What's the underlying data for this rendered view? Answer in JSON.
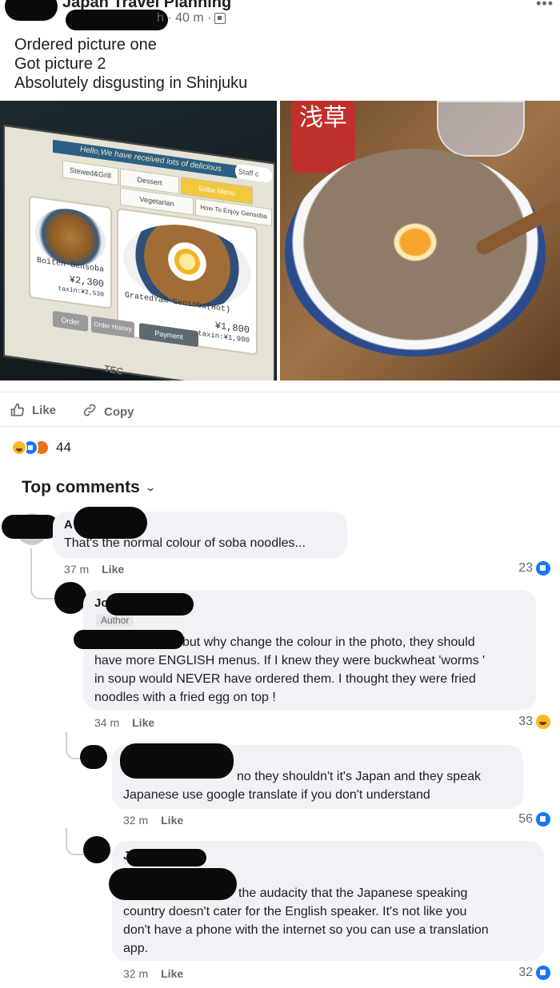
{
  "header": {
    "group_name": "Japan Travel Planning",
    "post_time": "h · 40 m ·"
  },
  "post": {
    "lines": [
      "Ordered picture one",
      "Got picture 2",
      "Absolutely disgusting in Shinjuku"
    ]
  },
  "photo_left": {
    "banner": "Hello,We have received lots of delicious food!",
    "staff_call": "Staff c",
    "tabs": [
      "Stewed&Grill",
      "Dessert",
      "Soba Menu",
      "Vegetarian",
      "How To Enjoy Gensoba"
    ],
    "card_small_name": "Boiten Gensoba",
    "card_small_price": "¥2,300",
    "card_small_tax": "taxin:¥2,530",
    "card_big_name": "GratedYam Gensoba(Hot)",
    "card_big_price": "¥1,800",
    "card_big_tax": "taxin:¥1,980",
    "buttons": [
      "Order",
      "Order History",
      "Payment"
    ],
    "brand": "TEC"
  },
  "photo_right": {
    "bottle_label": "浅草"
  },
  "actions": {
    "like": "Like",
    "copy": "Copy"
  },
  "reactions": {
    "count": "44"
  },
  "comments_header": "Top comments",
  "comments": [
    {
      "text": "That's the normal colour of soba noodles...",
      "time": "37 m",
      "like": "Like",
      "count": "23"
    },
    {
      "name": "Jo",
      "badge": "Author",
      "text_lines": [
        "but why change the colour in the photo, they should",
        "have more ENGLISH menus. If I knew they were buckwheat 'worms '",
        "in soup would NEVER have ordered them. I thought they were fried",
        "noodles with a fried egg on top !"
      ],
      "time": "34 m",
      "like": "Like",
      "count": "33"
    },
    {
      "text_lines": [
        "no they shouldn't it's Japan and they speak",
        "Japanese use google translate if you don't understand"
      ],
      "time": "32 m",
      "like": "Like",
      "count": "56"
    },
    {
      "name": "J",
      "text_lines": [
        "the audacity that the Japanese speaking",
        "country doesn't cater for the English speaker. It's not like you",
        "don't have a phone with the internet so you can use a translation",
        "app."
      ],
      "time": "32 m",
      "like": "Like",
      "count": "32"
    }
  ]
}
